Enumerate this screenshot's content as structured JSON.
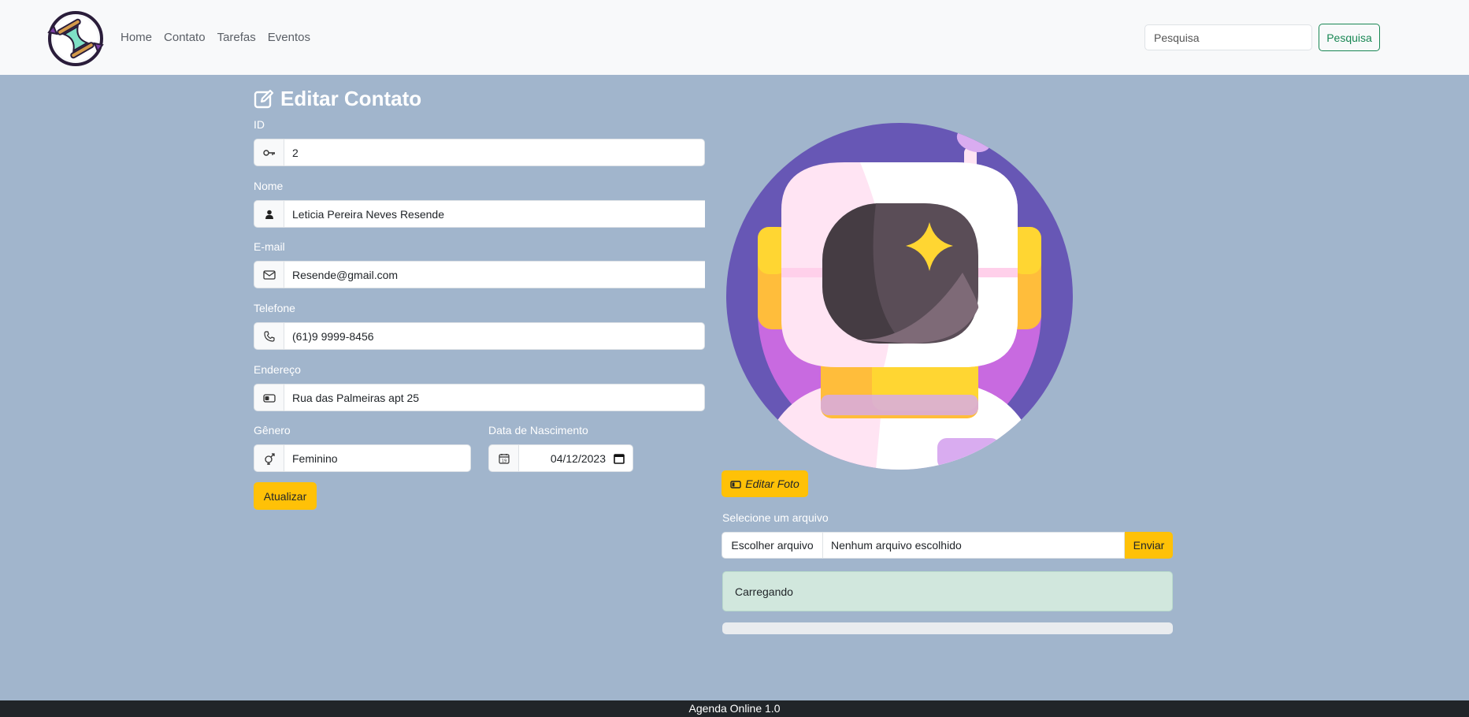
{
  "navbar": {
    "links": [
      "Home",
      "Contato",
      "Tarefas",
      "Eventos"
    ],
    "search_placeholder": "Pesquisa",
    "search_button": "Pesquisa"
  },
  "page": {
    "title": "Editar Contato"
  },
  "form": {
    "id_label": "ID",
    "id_value": "2",
    "name_label": "Nome",
    "name_value": "Leticia Pereira Neves Resende",
    "email_label": "E-mail",
    "email_value": "Resende@gmail.com",
    "phone_label": "Telefone",
    "phone_value": "(61)9 9999-8456",
    "address_label": "Endereço",
    "address_value": "Rua das Palmeiras apt 25",
    "gender_label": "Gênero",
    "gender_value": "Feminino",
    "birth_label": "Data de Nascimento",
    "birth_value": "04/12/2023",
    "update_button": "Atualizar"
  },
  "photo": {
    "edit_button": "Editar Foto",
    "file_label": "Selecione um arquivo",
    "choose_button": "Escolher arquivo",
    "no_file": "Nenhum arquivo escolhido",
    "send_button": "Enviar",
    "status": "Carregando",
    "progress": 0
  },
  "footer": {
    "text": "Agenda Online 1.0"
  },
  "colors": {
    "accent": "#ffc107",
    "success": "#198754",
    "background": "#a1b5cc",
    "alert": "#d1e7dd"
  }
}
